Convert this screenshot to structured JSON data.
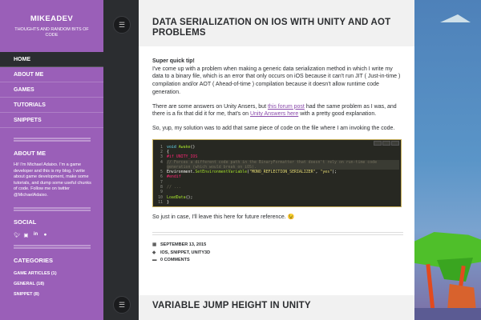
{
  "site": {
    "title": "MIKEADEV",
    "tagline": "THOUGHTS AND RANDOM BITS OF CODE"
  },
  "nav": [
    {
      "label": "HOME",
      "active": true
    },
    {
      "label": "ABOUT ME",
      "active": false
    },
    {
      "label": "GAMES",
      "active": false
    },
    {
      "label": "TUTORIALS",
      "active": false
    },
    {
      "label": "SNIPPETS",
      "active": false
    }
  ],
  "about": {
    "title": "ABOUT ME",
    "text": "Hi! I'm Michael Adaixo. I'm a game developer and this is my blog. I write about game development, make some tutorials, and dump some useful chunks of code. Follow me on twitter @MichaelAdaixo."
  },
  "social": {
    "title": "SOCIAL",
    "icons": [
      "twitter-icon",
      "instagram-icon",
      "linkedin-icon",
      "github-icon"
    ]
  },
  "categories": {
    "title": "CATEGORIES",
    "items": [
      {
        "label": "GAME ARTICLES (1)"
      },
      {
        "label": "GENERAL (18)"
      },
      {
        "label": "SNIPPET (8)"
      }
    ]
  },
  "post": {
    "title": "DATA SERIALIZATION ON IOS WITH UNITY AND AOT PROBLEMS",
    "lead": "Super quick tip!",
    "p1": "I've come up with a problem when making a generic data serialization method in which I write my data to a binary file, which is an error that only occurs on iOS because it can't run JIT ( Just-in-time ) compilation and/or AOT ( Ahead-of-time ) compilation because it doesn't allow runtime code generation.",
    "p2_a": "There are some answers on Unity Ansers, but ",
    "p2_link1": "this forum post",
    "p2_b": " had the same problem as I was, and there is a fix that did it for me, that's on ",
    "p2_link2": "Unity Answers here",
    "p2_c": " with a pretty good explanation.",
    "p3": "So, yup, my solution was to add that same piece of code on the file where I am invoking the code.",
    "code": {
      "line_numbers": [
        "1",
        "2",
        "3",
        "4",
        "5",
        "6",
        "7",
        "8",
        "9",
        "10",
        "11"
      ],
      "l1_kw": "void ",
      "l1_fn": "Awake",
      "l1_rest": "()",
      "l2": "{",
      "l3": "#if UNITY_IOS",
      "l4": "    // Forces a different code path in the BinaryFormatter that doesn't rely on run-time code generation (which would break on iOS).",
      "l5_a": "    Environment.",
      "l5_fn": "SetEnvironmentVariable",
      "l5_b": "(",
      "l5_s1": "\"MONO_REFLECTION_SERIALIZER\"",
      "l5_c": ", ",
      "l5_s2": "\"yes\"",
      "l5_d": ");",
      "l6": "#endif",
      "l7": "",
      "l8": "    // ...",
      "l9": "",
      "l10_fn": "    LoadData",
      "l10_rest": "();",
      "l11": "}"
    },
    "p4": "So just in case, I'll leave this here for future reference. 😉",
    "meta": {
      "date": "SEPTEMBER 13, 2015",
      "tags": "IOS, SNIPPET, UNITY3D",
      "comments": "0 COMMENTS"
    }
  },
  "next_post": {
    "title": "VARIABLE JUMP HEIGHT IN UNITY"
  }
}
